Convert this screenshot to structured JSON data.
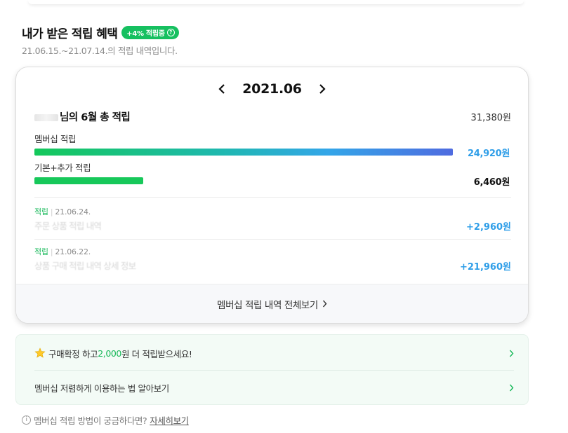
{
  "header": {
    "title": "내가 받은 적립 혜택",
    "badge": "+4% 적립중",
    "badge_help": "?",
    "period": "21.06.15.~21.07.14.의 적립 내역입니다."
  },
  "card": {
    "month": "2021.06",
    "summary_title": "님의 6월 총 적립",
    "summary_total": "31,380원",
    "membership": {
      "label": "멤버십 적립",
      "value": "24,920원",
      "ratio": 1.0
    },
    "basic": {
      "label": "기본+추가 적립",
      "value": "6,460원",
      "ratio": 0.26
    },
    "history": [
      {
        "type": "적립",
        "date": "21.06.24.",
        "desc": "주문 상품 적립 내역",
        "amount": "+2,960원"
      },
      {
        "type": "적립",
        "date": "21.06.22.",
        "desc": "상품 구매 적립 내역 상세 정보",
        "amount": "+21,960원"
      }
    ],
    "footer_link": "멤버십 적립 내역 전체보기"
  },
  "tips": {
    "tip1_pre": "구매확정 하고 ",
    "tip1_highlight": "2,000",
    "tip1_post": "원 더 적립받으세요!",
    "tip2": "멤버십 저렴하게 이용하는 법 알아보기"
  },
  "help": {
    "icon": "i",
    "text": "멤버십 적립 방법이 궁금하다면?",
    "link": "자세히보기"
  },
  "colors": {
    "accent_green": "#16c060",
    "amount_blue": "#2f9ee8"
  }
}
